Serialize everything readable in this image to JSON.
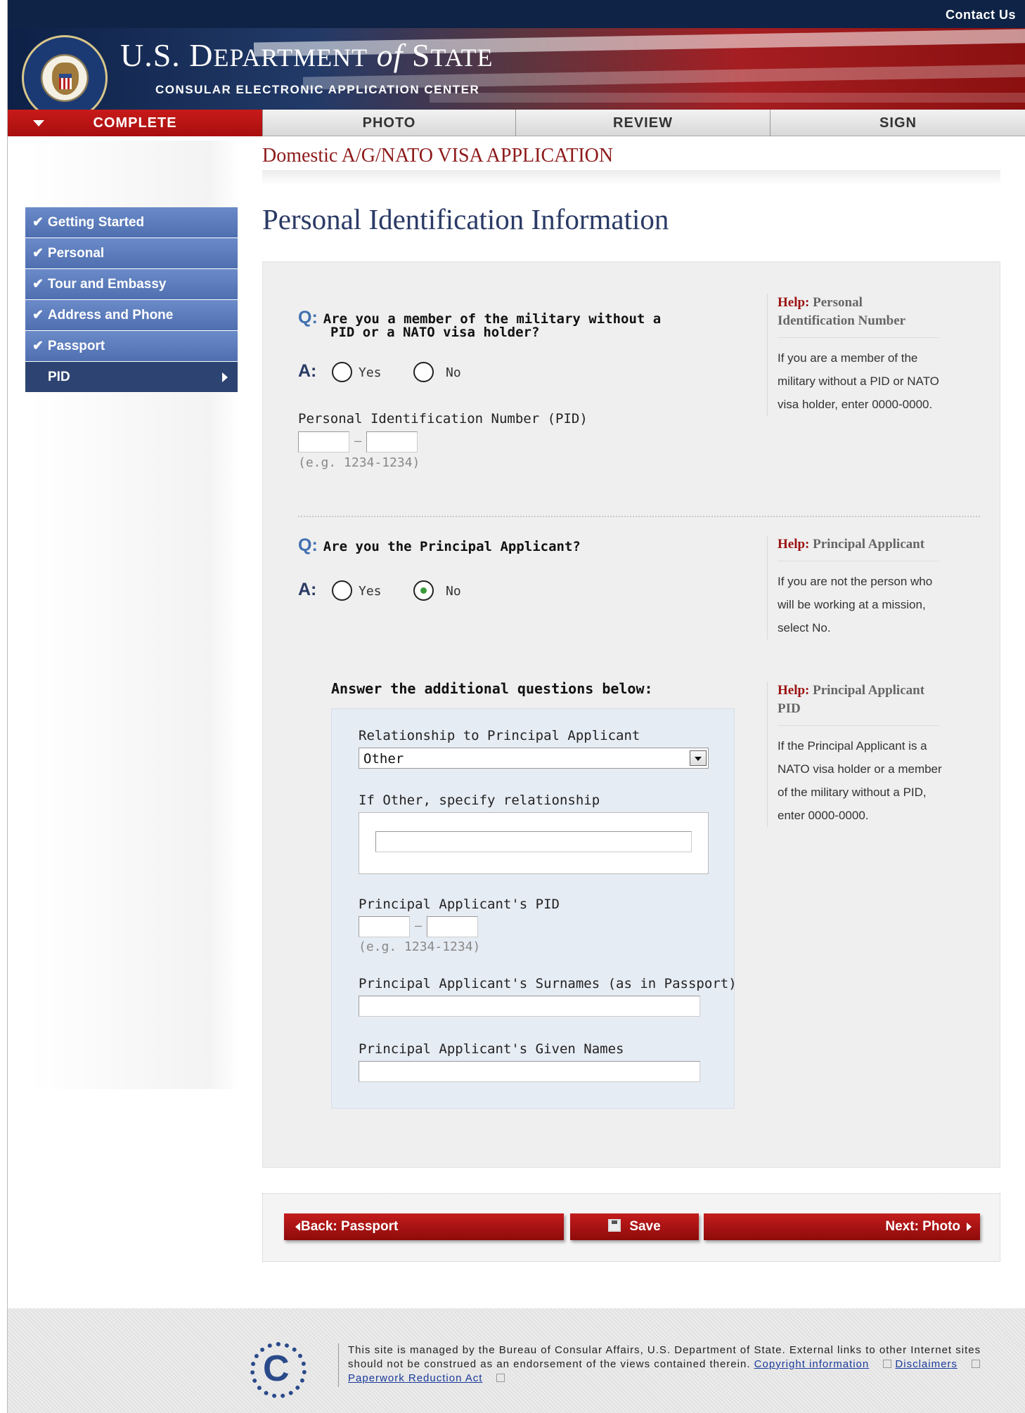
{
  "header": {
    "contact_label": "Contact Us",
    "dept_prefix": "U.S. D",
    "dept_name_a": "EPARTMENT",
    "dept_of": "of",
    "dept_s": "S",
    "dept_name_b": "TATE",
    "subtitle": "CONSULAR ELECTRONIC APPLICATION CENTER"
  },
  "steps": [
    {
      "label": "COMPLETE",
      "active": true
    },
    {
      "label": "PHOTO"
    },
    {
      "label": "REVIEW"
    },
    {
      "label": "SIGN"
    }
  ],
  "application_title": "Domestic A/G/NATO VISA APPLICATION",
  "sidebar": {
    "items": [
      {
        "label": "Getting Started",
        "check": "✔"
      },
      {
        "label": "Personal",
        "check": "✔"
      },
      {
        "label": "Tour and Embassy",
        "check": "✔"
      },
      {
        "label": "Address and Phone",
        "check": "✔"
      },
      {
        "label": "Passport",
        "check": "✔"
      },
      {
        "label": "PID",
        "current": true
      }
    ]
  },
  "page_title": "Personal Identification Information",
  "q1": {
    "q_marker": "Q:",
    "question_line1": "Are you a  member of the military without a",
    "question_line2": "PID or a NATO visa  holder?",
    "a_marker": "A:",
    "yes": "Yes",
    "no": "No",
    "selected": null,
    "pid_label": "Personal Identification Number (PID)",
    "pid_part1": "",
    "pid_part2": "",
    "pid_hint": "(e.g. 1234-1234)",
    "help_label": "Help:",
    "help_title": "Personal Identification Number",
    "help_text": "If you  are a member of the military without a PID or NATO visa holder, enter 0000-0000."
  },
  "q2": {
    "q_marker": "Q:",
    "question": "Are you the  Principal Applicant?",
    "a_marker": "A:",
    "yes": "Yes",
    "no": "No",
    "selected": "No",
    "help_label": "Help:",
    "help_title": "Principal Applicant",
    "help_text": "If you are not the person who will be working at a mission, select No."
  },
  "additional": {
    "heading": "Answer the additional questions below:",
    "relationship_label": "Relationship to Principal Applicant",
    "relationship_value": "Other",
    "other_label": "If Other, specify relationship",
    "other_value": "",
    "pa_pid_label": "Principal Applicant's PID",
    "pa_pid_hint": "(e.g. 1234-1234)",
    "surnames_label": "Principal Applicant's Surnames (as in Passport)",
    "surnames_value": "",
    "given_label": "Principal Applicant's Given Names",
    "given_value": "",
    "help_label": "Help:",
    "help_title": "Principal Applicant PID",
    "help_text": "If the Principal Applicant is a NATO visa holder or a member of the military without a PID, enter 0000-0000."
  },
  "nav": {
    "back": "Back:  Passport",
    "save": "Save",
    "next": "Next: Photo"
  },
  "footer": {
    "logo_letter": "C",
    "text": "This site is managed by the Bureau of Consular Affairs, U.S. Department of State. External links to other Internet sites should not be construed as an endorsement of the views contained therein.",
    "link_copyright": "Copyright information",
    "link_disclaimers": "Disclaimers",
    "link_paperwork": "Paperwork Reduction Act"
  },
  "colors": {
    "brand_red": "#a80e0e",
    "nav_blue": "#4f6fb0",
    "title_red": "#8e1a1a",
    "selected_radio": "#3a9a3a"
  }
}
